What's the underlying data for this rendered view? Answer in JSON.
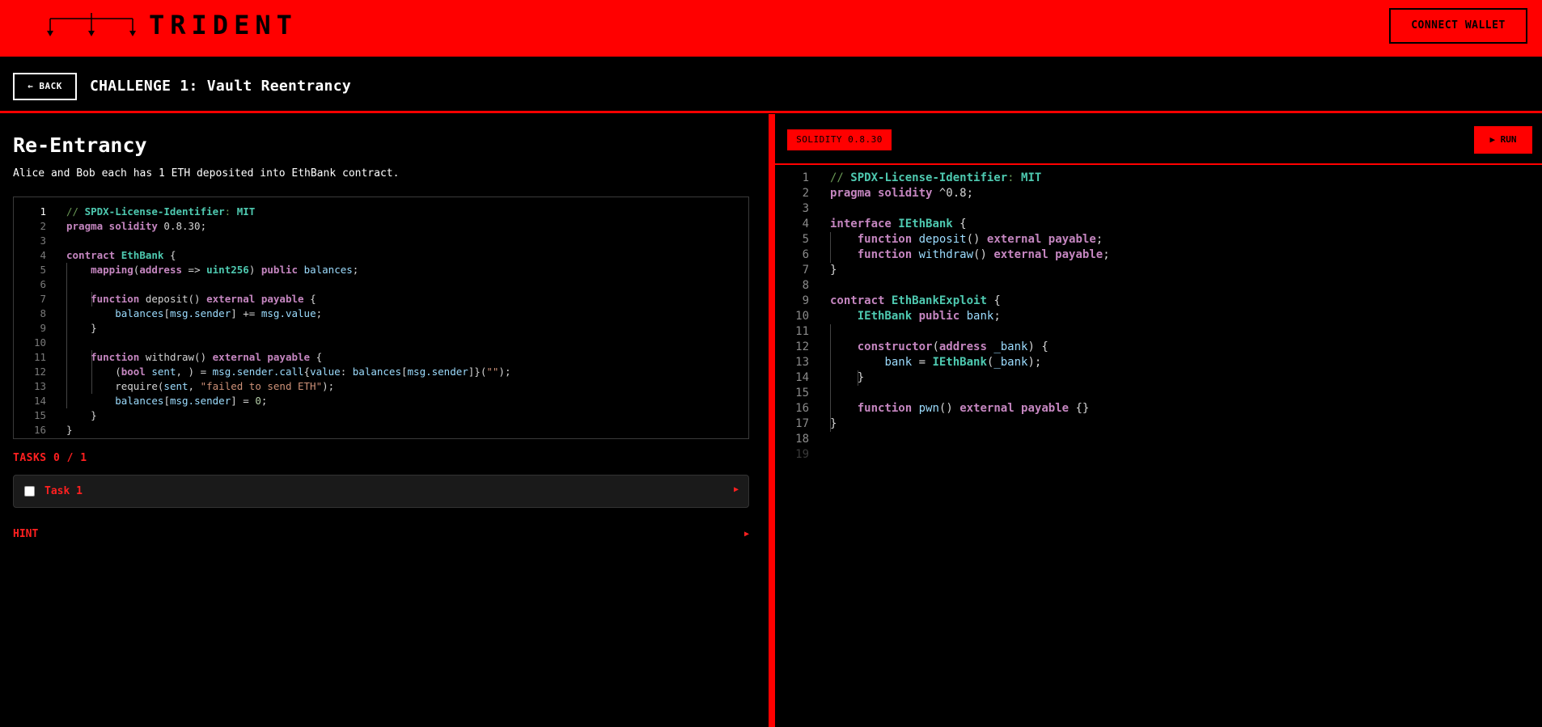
{
  "header": {
    "brand": "TRIDENT",
    "connect_label": "CONNECT WALLET"
  },
  "titlebar": {
    "back_label": "← BACK",
    "challenge_title": "CHALLENGE 1: Vault Reentrancy"
  },
  "left": {
    "heading": "Re-Entrancy",
    "description": "Alice and Bob each has 1 ETH deposited into EthBank contract.",
    "code_lines": [
      "// SPDX-License-Identifier: MIT",
      "pragma solidity 0.8.30;",
      "",
      "contract EthBank {",
      "    mapping(address => uint256) public balances;",
      "",
      "    function deposit() external payable {",
      "        balances[msg.sender] += msg.value;",
      "    }",
      "",
      "    function withdraw() external payable {",
      "        (bool sent, ) = msg.sender.call{value: balances[msg.sender]}(\"\");",
      "        require(sent, \"failed to send ETH\");",
      "        balances[msg.sender] = 0;",
      "    }",
      "}"
    ],
    "tasks_label": "TASKS 0 / 1",
    "tasks": [
      {
        "label": "Task 1",
        "checked": false
      }
    ],
    "hint_label": "HINT"
  },
  "right": {
    "compiler_badge": "SOLIDITY 0.8.30",
    "run_label": "▶ RUN",
    "code_lines": [
      "// SPDX-License-Identifier: MIT",
      "pragma solidity ^0.8;",
      "",
      "interface IEthBank {",
      "    function deposit() external payable;",
      "    function withdraw() external payable;",
      "}",
      "",
      "contract EthBankExploit {",
      "    IEthBank public bank;",
      "",
      "    constructor(address _bank) {",
      "        bank = IEthBank(_bank);",
      "    }",
      "",
      "    function pwn() external payable {}",
      "}",
      "",
      ""
    ]
  },
  "colors": {
    "accent": "#ff0000",
    "background": "#000000",
    "panel": "#1a1a1a"
  },
  "icons": {
    "logo": "trident-logo-icon",
    "task_expand": "play-triangle-icon",
    "hint_expand": "play-triangle-icon"
  }
}
